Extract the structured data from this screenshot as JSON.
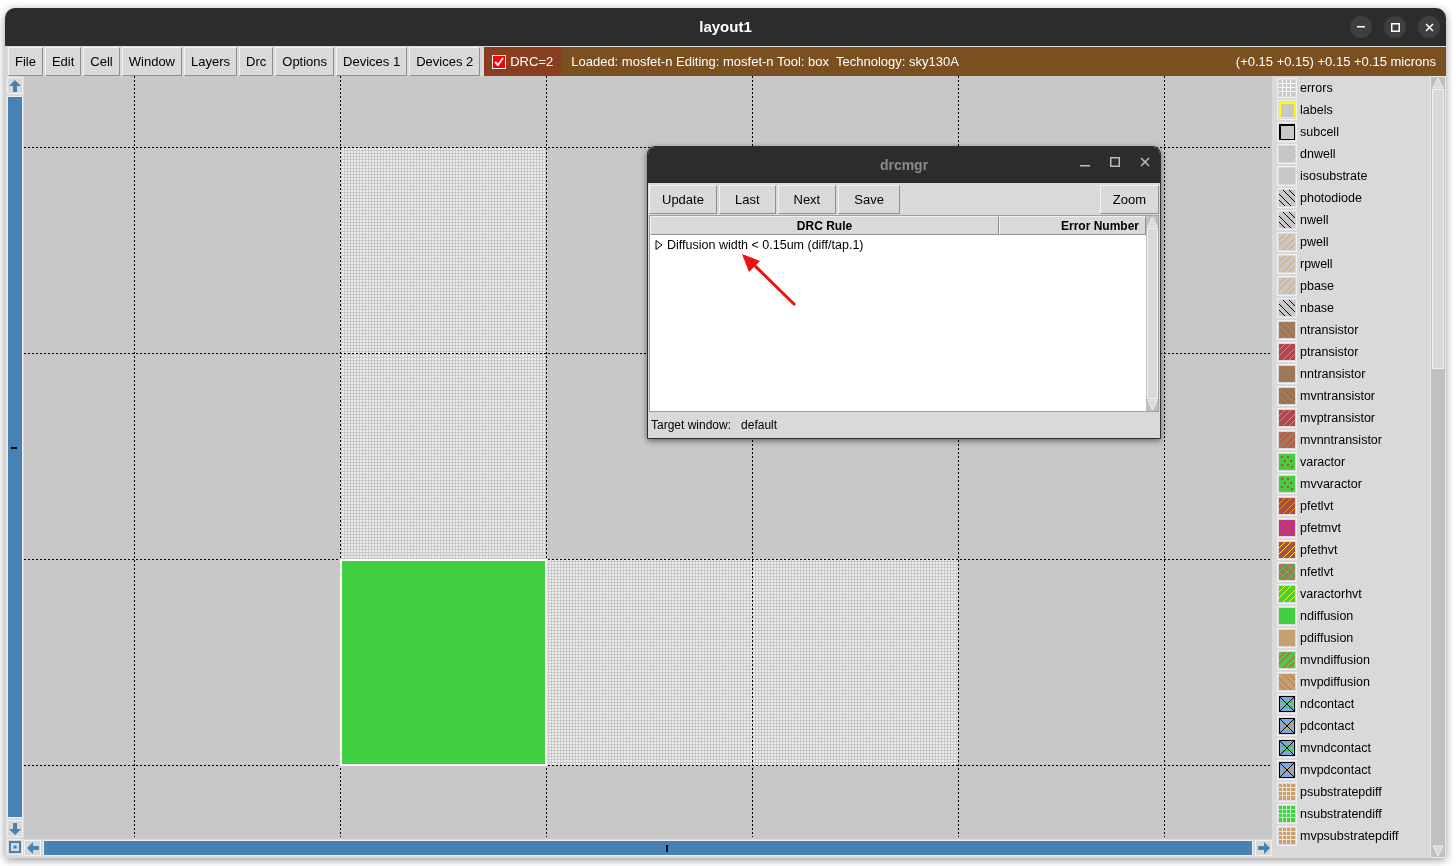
{
  "window": {
    "title": "layout1"
  },
  "menu": [
    "File",
    "Edit",
    "Cell",
    "Window",
    "Layers",
    "Drc",
    "Options",
    "Devices 1",
    "Devices 2"
  ],
  "drc_toggle": {
    "label": "DRC=2",
    "checked": true
  },
  "status": {
    "text": "Loaded: mosfet-n Editing: mosfet-n Tool: box  Technology: sky130A",
    "coordinates": "(+0.15 +0.15) +0.15 +0.15 microns"
  },
  "layers": [
    {
      "name": "errors",
      "kind": "grid",
      "color": "#c8c8c8",
      "stripes": {
        "color": "#ffffff"
      }
    },
    {
      "name": "labels",
      "kind": "outline",
      "color": "#c8c8c8",
      "stripes": {
        "color": "#ffff00"
      }
    },
    {
      "name": "subcell",
      "kind": "outline",
      "color": "#c8c8c8",
      "stripes": {
        "color": "#000000"
      }
    },
    {
      "name": "dnwell",
      "kind": "hatch",
      "color": "#c8c8c8",
      "stripes": {
        "color": "#e0d000"
      }
    },
    {
      "name": "isosubstrate",
      "kind": "plain",
      "color": "#c8c8c8"
    },
    {
      "name": "photodiode",
      "kind": "hatch",
      "color": "#c8c8c8",
      "stripes": {
        "color": "#000000"
      }
    },
    {
      "name": "nwell",
      "kind": "hatch",
      "color": "#c8c8c8",
      "stripes": {
        "color": "#000000"
      }
    },
    {
      "name": "pwell",
      "kind": "slash",
      "color": "#c8c8c8",
      "stripes": {
        "color": "#d0a070"
      }
    },
    {
      "name": "rpwell",
      "kind": "slash",
      "color": "#c8c8c8",
      "stripes": {
        "color": "#d0a070"
      }
    },
    {
      "name": "pbase",
      "kind": "slash",
      "color": "#c8c8c8",
      "stripes": {
        "color": "#d0a070"
      }
    },
    {
      "name": "nbase",
      "kind": "hatch",
      "color": "#c8c8c8",
      "stripes": {
        "color": "#000000"
      }
    },
    {
      "name": "ntransistor",
      "kind": "hatch",
      "color": "#a07858",
      "stripes": {
        "color": "#40d040"
      }
    },
    {
      "name": "ptransistor",
      "kind": "slash",
      "color": "#b04850",
      "stripes": {
        "color": "#e08080"
      }
    },
    {
      "name": "nntransistor",
      "kind": "plain",
      "color": "#a07858"
    },
    {
      "name": "mvntransistor",
      "kind": "hatch",
      "color": "#a07858",
      "stripes": {
        "color": "#d04040"
      }
    },
    {
      "name": "mvptransistor",
      "kind": "slash",
      "color": "#b04850",
      "stripes": {
        "color": "#e08080"
      }
    },
    {
      "name": "mvnntransistor",
      "kind": "slash",
      "color": "#a07858",
      "stripes": {
        "color": "#c04040"
      }
    },
    {
      "name": "varactor",
      "kind": "dots",
      "color": "#40d040",
      "stripes": {
        "color": "#d04040"
      }
    },
    {
      "name": "mvvaractor",
      "kind": "dots",
      "color": "#40d040",
      "stripes": {
        "color": "#d04040"
      }
    },
    {
      "name": "pfetlvt",
      "kind": "slash",
      "color": "#b04850",
      "stripes": {
        "color": "#e0a000"
      }
    },
    {
      "name": "pfetmvt",
      "kind": "slash",
      "color": "#b04850",
      "stripes": {
        "color": "#e000e0"
      }
    },
    {
      "name": "pfethvt",
      "kind": "slash",
      "color": "#b04850",
      "stripes": {
        "color": "#ffff00"
      }
    },
    {
      "name": "nfetlvt",
      "kind": "cross",
      "color": "#a07858",
      "stripes": {
        "color": "#40d040"
      }
    },
    {
      "name": "varactorhvt",
      "kind": "slash",
      "color": "#40d040",
      "stripes": {
        "color": "#ffff00"
      }
    },
    {
      "name": "ndiffusion",
      "kind": "plain",
      "color": "#40d040"
    },
    {
      "name": "pdiffusion",
      "kind": "plain",
      "color": "#c8a070"
    },
    {
      "name": "mvndiffusion",
      "kind": "slash",
      "color": "#40d040",
      "stripes": {
        "color": "#d04040"
      }
    },
    {
      "name": "mvpdiffusion",
      "kind": "hatch",
      "color": "#c8a070",
      "stripes": {
        "color": "#a07858"
      }
    },
    {
      "name": "ndcontact",
      "kind": "contact",
      "color": "#80a8e0",
      "stripes": {
        "color": "#40d040"
      }
    },
    {
      "name": "pdcontact",
      "kind": "contact",
      "color": "#80a8e0",
      "stripes": {
        "color": "#c8a070"
      }
    },
    {
      "name": "mvndcontact",
      "kind": "contact",
      "color": "#80a8e0",
      "stripes": {
        "color": "#40d040"
      }
    },
    {
      "name": "mvpdcontact",
      "kind": "contact",
      "color": "#80a8e0",
      "stripes": {
        "color": "#c8a070"
      }
    },
    {
      "name": "psubstratepdiff",
      "kind": "grid",
      "color": "#c8a070",
      "stripes": {
        "color": "#f0e0d0"
      }
    },
    {
      "name": "nsubstratendiff",
      "kind": "grid",
      "color": "#40d040",
      "stripes": {
        "color": "#c0f0c0"
      }
    },
    {
      "name": "mvpsubstratepdiff",
      "kind": "grid",
      "color": "#c8a070",
      "stripes": {
        "color": "#f0e0d0"
      }
    }
  ],
  "drcmgr": {
    "title": "drcmgr",
    "buttons": [
      "Update",
      "Last",
      "Next",
      "Save"
    ],
    "zoom_button": "Zoom",
    "columns": [
      "DRC Rule",
      "Error Number"
    ],
    "rows": [
      {
        "rule": "Diffusion width < 0.15um (diff/tap.1)",
        "expanded": false
      }
    ],
    "target_label": "Target window:",
    "target_value": "default"
  }
}
